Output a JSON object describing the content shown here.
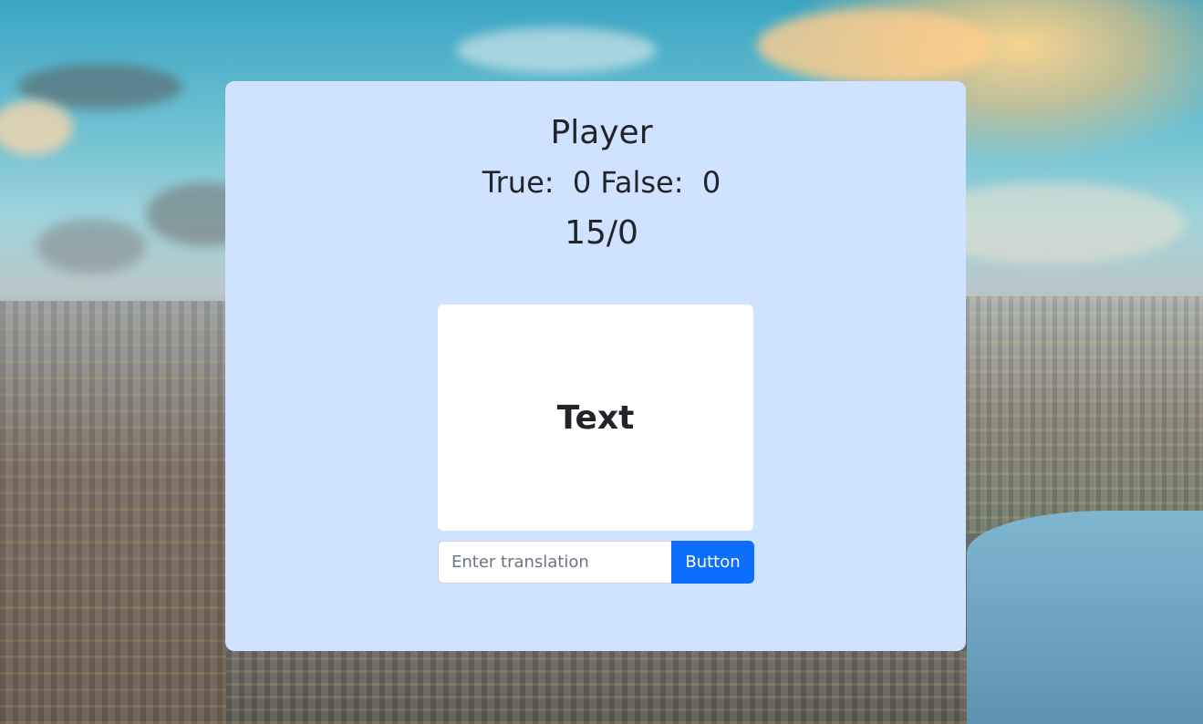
{
  "header": {
    "player_label": "Player",
    "true_label": "True:",
    "true_count": "0",
    "false_label": "False:",
    "false_count": "0",
    "counter": "15/0"
  },
  "card": {
    "word": "Text"
  },
  "form": {
    "input_value": "",
    "input_placeholder": "Enter translation",
    "button_label": "Button"
  },
  "colors": {
    "panel_background": "#cfe2ff",
    "button_primary": "#0d6efd",
    "text": "#212529"
  }
}
